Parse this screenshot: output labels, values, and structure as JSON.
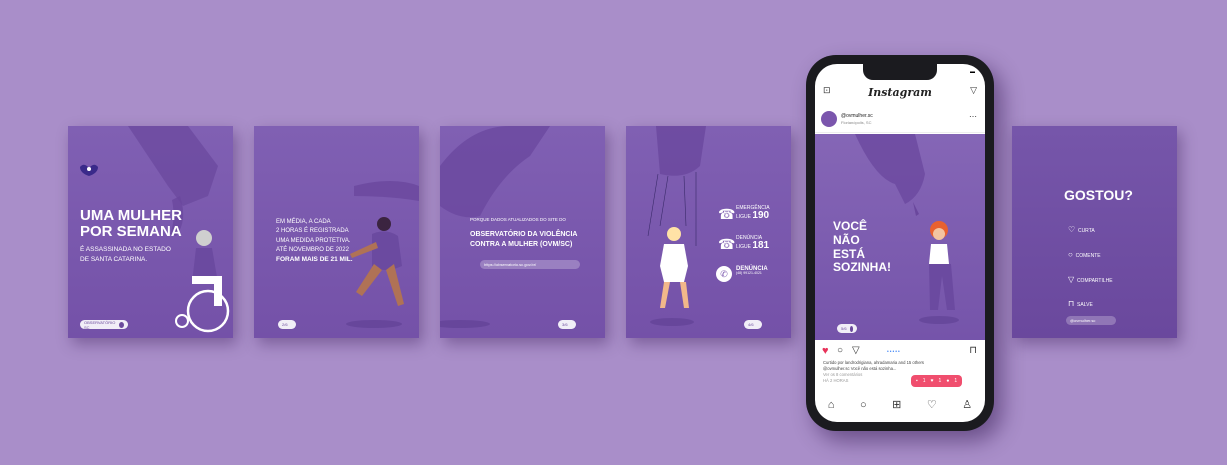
{
  "colors": {
    "background": "#a98ec9",
    "card": "#7a57ad",
    "accent_red": "#e8325a",
    "accent_pink": "#f04e6e"
  },
  "card1": {
    "headline_1": "UMA MULHER",
    "headline_2": "POR SEMANA",
    "sub_1": "É ASSASSINADA NO ESTADO",
    "sub_2": "DE SANTA CATARINA.",
    "pill": "OBSERVATÓRIO SC"
  },
  "card2": {
    "line_1": "EM MÉDIA, A CADA",
    "line_2": "2 HORAS É REGISTRADA",
    "line_3": "UMA MEDIDA PROTETIVA.",
    "line_4": "ATÉ NOVEMBRO DE 2022",
    "line_5": "FORAM MAIS DE 21 MIL.",
    "pill": "2/6"
  },
  "card3": {
    "intro": "PORQUE DADOS ATUALIZADOS DO SITE DO",
    "bold_1": "OBSERVATÓRIO DA VIOLÊNCIA",
    "bold_2": "CONTRA A MULHER (OVM/SC)",
    "link": "https://observatorio.sc.gov.br/",
    "pill": "3/6"
  },
  "card4": {
    "c1_label": "EMERGÊNCIA",
    "c1_prefix": "LIGUE",
    "c1_num": "190",
    "c2_label": "DENÚNCIA",
    "c2_prefix": "LIGUE",
    "c2_num": "181",
    "c3_label": "DENÚNCIA",
    "c3_sub": "(48) 99121-4021",
    "pill": "4/6"
  },
  "phone": {
    "app_title": "Instagram",
    "username": "@ovmulher.sc",
    "subtitle": "Florianópolis, SC",
    "post_line_1": "VOCÊ",
    "post_line_2": "NÃO",
    "post_line_3": "ESTÁ",
    "post_line_4": "SOZINHA!",
    "post_pill": "5/6",
    "likes_text": "Curtido por landrodrigiana, ahradamaria and 15 others",
    "caption_text": "@ovmulher.sc Você não está sozinha...",
    "comments_text": "Ver os 8 comentários",
    "time_text": "HÁ 2 HORAS",
    "notif_comments": "1",
    "notif_likes": "1",
    "notif_follows": "1"
  },
  "card6": {
    "title": "GOSTOU?",
    "item_1": "CURTA",
    "item_2": "COMENTE",
    "item_3": "COMPARTILHE",
    "item_4": "SALVE",
    "pill": "@ovmulher.sc"
  }
}
